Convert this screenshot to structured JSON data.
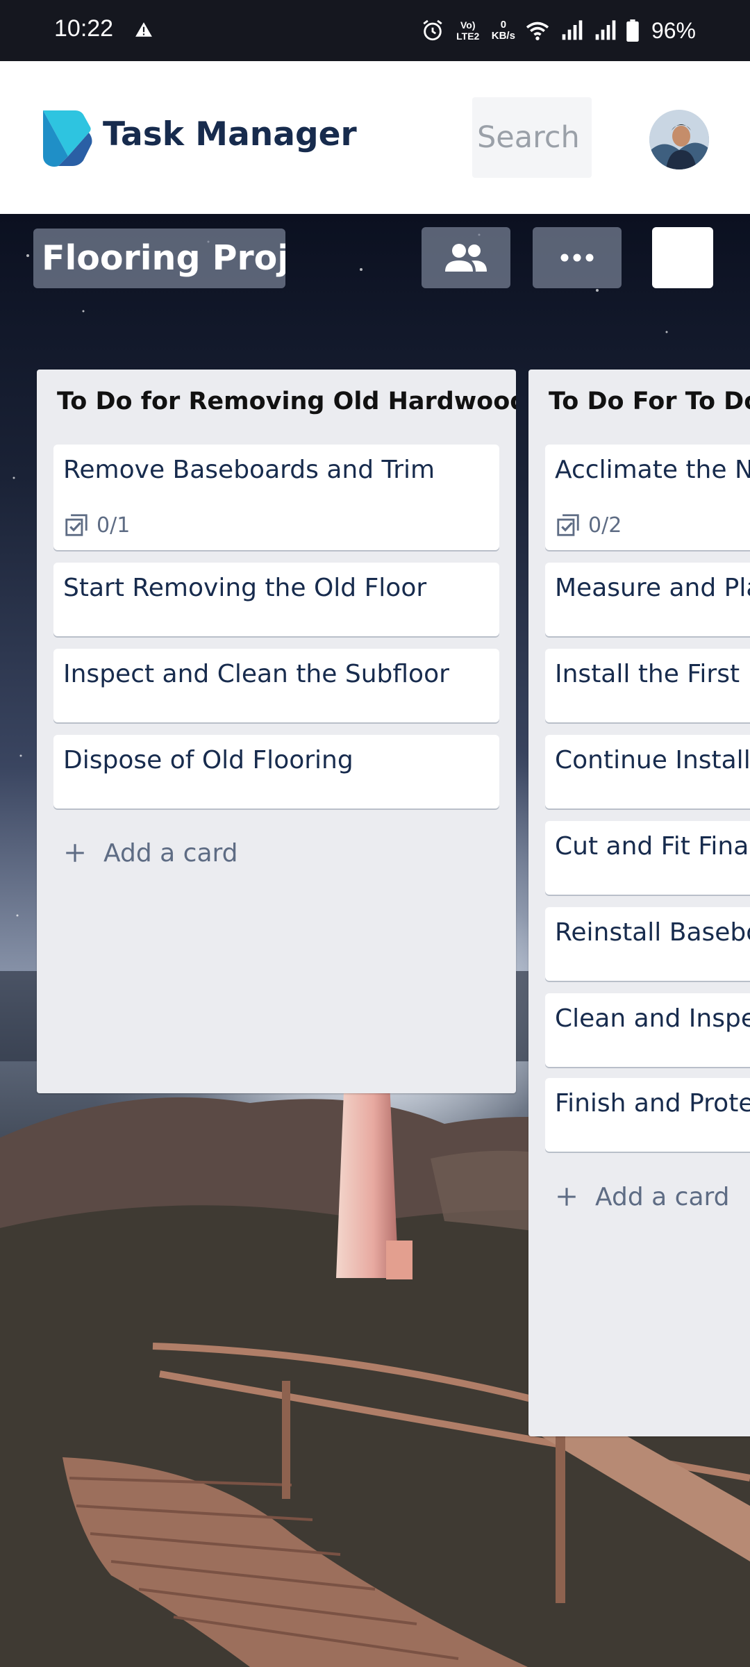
{
  "status_bar": {
    "time": "10:22",
    "net_speed_value": "0",
    "net_speed_unit": "KB/s",
    "volte": "Vo) LTE2",
    "battery": "96%"
  },
  "header": {
    "app_title": "Task Manager",
    "search_placeholder": "Search boards",
    "brand_colors": {
      "logo_light": "#2ec4e0",
      "logo_dark": "#2a6fb5",
      "title": "#172b4d"
    }
  },
  "board": {
    "name": "Flooring Proj…",
    "lists": [
      {
        "title": "To Do for Removing Old Hardwood Floors",
        "cards": [
          {
            "title": "Remove Baseboards and Trim",
            "checklist": "0/1"
          },
          {
            "title": "Start Removing the Old Floor"
          },
          {
            "title": "Inspect and Clean the Subfloor"
          },
          {
            "title": "Dispose of Old Flooring"
          }
        ],
        "add_card_label": "Add a card"
      },
      {
        "title": "To Do For To Do for Installing New Floors",
        "cards": [
          {
            "title": "Acclimate the New Flooring",
            "checklist": "0/2"
          },
          {
            "title": "Measure and Plan Layout"
          },
          {
            "title": "Install the First Row"
          },
          {
            "title": "Continue Installing Rows"
          },
          {
            "title": "Cut and Fit Final Row"
          },
          {
            "title": "Reinstall Baseboards"
          },
          {
            "title": "Clean and Inspect"
          },
          {
            "title": "Finish and Protect"
          }
        ],
        "add_card_label": "Add a card"
      }
    ]
  }
}
